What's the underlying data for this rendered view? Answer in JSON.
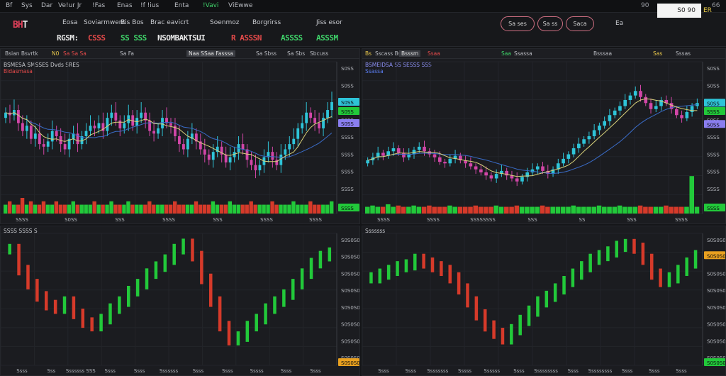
{
  "menubar": {
    "items": [
      "Bf",
      "Sys",
      "Dar",
      "Ve!ur Jr",
      "!Fas",
      "Enas",
      "!f !ius",
      "Enta",
      "!Vavi",
      "ViEwwe"
    ],
    "right_items": [
      "90",
      "66"
    ]
  },
  "toolbar": {
    "logo_prefix": "BH",
    "logo_suffix": "T",
    "tools": [
      "Eosa",
      "Soviarmwent",
      "Bis Bos",
      "Brac eavicrt",
      "Soenmoz",
      "Borgrirss",
      "Jiss esor"
    ],
    "tickers": [
      {
        "text": "RGSM:",
        "color": "#e8e8e8"
      },
      {
        "text": "CSSS",
        "color": "#e34a4a"
      },
      {
        "text": "SS SSS",
        "color": "#3fd46a"
      },
      {
        "text": "NSOMBAKTSUI",
        "color": "#e8e8e8"
      },
      {
        "text": "R ASSSN",
        "color": "#e34a4a"
      },
      {
        "text": "ASSSS",
        "color": "#3fd46a"
      },
      {
        "text": "ASSSM",
        "color": "#3fd46a"
      }
    ],
    "pills": [
      "Sa ses",
      "Sa ss",
      "Saca"
    ],
    "right_label": "Ea"
  },
  "price_box": {
    "value": "S0 90"
  },
  "price_suffix": "ER",
  "colors": {
    "bull": "#2ec4d8",
    "bear": "#d246a8",
    "green": "#22c93a",
    "red": "#d63a2a",
    "ma_slow": "#3a6cc8",
    "ma_fast": "#d8d27a",
    "background": "#1b1c20"
  },
  "panels": [
    {
      "tabs": [
        "Bsian Bsvrtk",
        "N0",
        "Sa Sa Sa",
        "Sa Fa",
        "Naa SSaa Fasssa",
        "Sa Sbss",
        "Sa Sbs",
        "Sbcuss"
      ],
      "legend_line1": "BSMESA SMSSES Dvds SRES",
      "legend_line2": "Bidasmasa",
      "price_labels": [
        "S0SS",
        "S0SS",
        "SSSS",
        "S0SS",
        "SSSS",
        "SSSS",
        "SSSS",
        "SSSS",
        "SSSS"
      ],
      "highlight_labels": [
        "S0SS",
        "S0SS",
        "S0SS",
        "SSSS"
      ],
      "time_labels": [
        "SSSS",
        "S0SS",
        "SSS",
        "SSSS",
        "SSS",
        "SSSS",
        "SSSS"
      ]
    },
    {
      "tabs": [
        "Bs",
        "Sscass Bs",
        "Bsssm",
        "Ssaa",
        "Saa",
        "Ssassa",
        "Bsssaa",
        "Sas",
        "Sssas"
      ],
      "legend_line1": "BSMEIDSA SS SESSS SSS",
      "legend_line2": "Ssassa",
      "price_labels": [
        "S0SS",
        "S0SS",
        "SSSS",
        "S0SS",
        "SSSS",
        "SSSS",
        "SSSS",
        "SSSS",
        "SSSS"
      ],
      "highlight_labels": [
        "S0SS",
        "S0SS",
        "SSSS",
        "SSSS"
      ],
      "time_labels": [
        "SSSS",
        "SSSS",
        "SSSSSSSS",
        "SSS",
        "SS",
        "SSS",
        "SSSS"
      ]
    },
    {
      "tabs": [],
      "legend_line1": "SSSS SSSS S",
      "legend_line2": "",
      "price_labels": [
        "S0S0S0",
        "S0S0S0",
        "S0S0S0",
        "S0S0S0",
        "S0S0S0",
        "S0S0S0",
        "S0S0S0",
        "S0S0S0"
      ],
      "highlight_labels": [
        "S0S0S0"
      ],
      "time_labels": [
        "Ssss",
        "Sss",
        "Sssssss SSS",
        "Ssss",
        "Ssss",
        "Sssssss",
        "Ssss",
        "Ssss",
        "Sssss",
        "Ssss",
        "Ssss"
      ]
    },
    {
      "tabs": [],
      "legend_line1": "Sssssss",
      "legend_line2": "",
      "price_labels": [
        "S0S0S0",
        "S0S0S0",
        "S0S0S0",
        "S0S0S0",
        "S0S0S0",
        "S0S0S0",
        "S0S0S0",
        "S0S0S0"
      ],
      "highlight_labels": [
        "S0S0S0",
        "S0S0S0"
      ],
      "time_labels": [
        "Ssss",
        "Ssss",
        "Ssssssss",
        "Sssss",
        "Ssssss",
        "Ssss",
        "Sssssssss",
        "Ssss",
        "Sssssssss",
        "Ssss",
        "Ssss",
        "Ssss"
      ]
    }
  ],
  "chart_data": [
    {
      "type": "candlestick",
      "series": [
        {
          "values": [
            62,
            61,
            63,
            58,
            55,
            57,
            52,
            54,
            50,
            49,
            51,
            55,
            53,
            50,
            48,
            52,
            54,
            50,
            53,
            55,
            57,
            56,
            58,
            55,
            60,
            62,
            59,
            56,
            58,
            61,
            57,
            60,
            62,
            59,
            55,
            54,
            56,
            60,
            58,
            57,
            53,
            50,
            48,
            52,
            54,
            51,
            48,
            46,
            44,
            47,
            49,
            46,
            43,
            45,
            47,
            50,
            48,
            44,
            42,
            40,
            42,
            45,
            47,
            44,
            42,
            46,
            48,
            50,
            52,
            56,
            58,
            62,
            60,
            58,
            56,
            60,
            63,
            66
          ]
        }
      ],
      "ma": [
        {
          "name": "",
          "values": "derived"
        }
      ],
      "volume": [
        1,
        2,
        1,
        1,
        3,
        1,
        2,
        1,
        1,
        2,
        1,
        1,
        2,
        1,
        1,
        1,
        2,
        1,
        1,
        1,
        1,
        2,
        1,
        1,
        1,
        2,
        1,
        1,
        1,
        2,
        1,
        1,
        1,
        1,
        2,
        1,
        1,
        1,
        1,
        1,
        2,
        1,
        1,
        1,
        1,
        2,
        1,
        1,
        1,
        2,
        1,
        1,
        1,
        2,
        1,
        1,
        1,
        1,
        2,
        1,
        1,
        1,
        1,
        2,
        1,
        1,
        1,
        1,
        2,
        1,
        1,
        1,
        2,
        1,
        1,
        1,
        1,
        2
      ]
    },
    {
      "type": "candlestick",
      "series": [
        {
          "values": [
            42,
            44,
            47,
            45,
            48,
            50,
            47,
            44,
            46,
            49,
            51,
            48,
            46,
            44,
            41,
            40,
            43,
            45,
            42,
            40,
            38,
            36,
            34,
            32,
            30,
            33,
            35,
            32,
            30,
            28,
            31,
            34,
            36,
            38,
            35,
            33,
            36,
            40,
            43,
            46,
            50,
            53,
            56,
            58,
            62,
            65,
            68,
            72,
            75,
            78,
            82,
            85,
            88,
            84,
            80,
            76,
            78,
            82,
            80,
            76,
            72,
            70,
            74,
            78,
            80
          ]
        }
      ],
      "ma": [
        {
          "name": "",
          "values": "derived"
        }
      ],
      "volume": [
        1,
        2,
        1,
        1,
        3,
        1,
        2,
        1,
        1,
        2,
        1,
        1,
        2,
        1,
        1,
        1,
        2,
        1,
        1,
        1,
        1,
        2,
        1,
        1,
        1,
        2,
        1,
        1,
        1,
        2,
        1,
        1,
        1,
        1,
        2,
        1,
        1,
        1,
        1,
        1,
        2,
        1,
        1,
        1,
        1,
        2,
        1,
        1,
        1,
        2,
        1,
        1,
        1,
        2,
        1,
        1,
        1,
        1,
        2,
        1,
        1,
        1,
        1,
        8,
        1
      ]
    },
    {
      "type": "bar",
      "series": [
        {
          "values": [
            92,
            80,
            72,
            65,
            60,
            58,
            62,
            55,
            50,
            48,
            52,
            58,
            62,
            68,
            72,
            78,
            82,
            86,
            92,
            95,
            88,
            75,
            62,
            48,
            40,
            42,
            48,
            52,
            58,
            62,
            66,
            72,
            78,
            84,
            88,
            90
          ]
        }
      ]
    },
    {
      "type": "bar",
      "series": [
        {
          "values": [
            68,
            70,
            72,
            74,
            75,
            78,
            76,
            74,
            72,
            68,
            62,
            55,
            48,
            42,
            38,
            35,
            40,
            45,
            50,
            55,
            58,
            62,
            66,
            70,
            74,
            78,
            80,
            82,
            85,
            86,
            84,
            78,
            70,
            66,
            68,
            72,
            76,
            80
          ]
        }
      ]
    }
  ]
}
